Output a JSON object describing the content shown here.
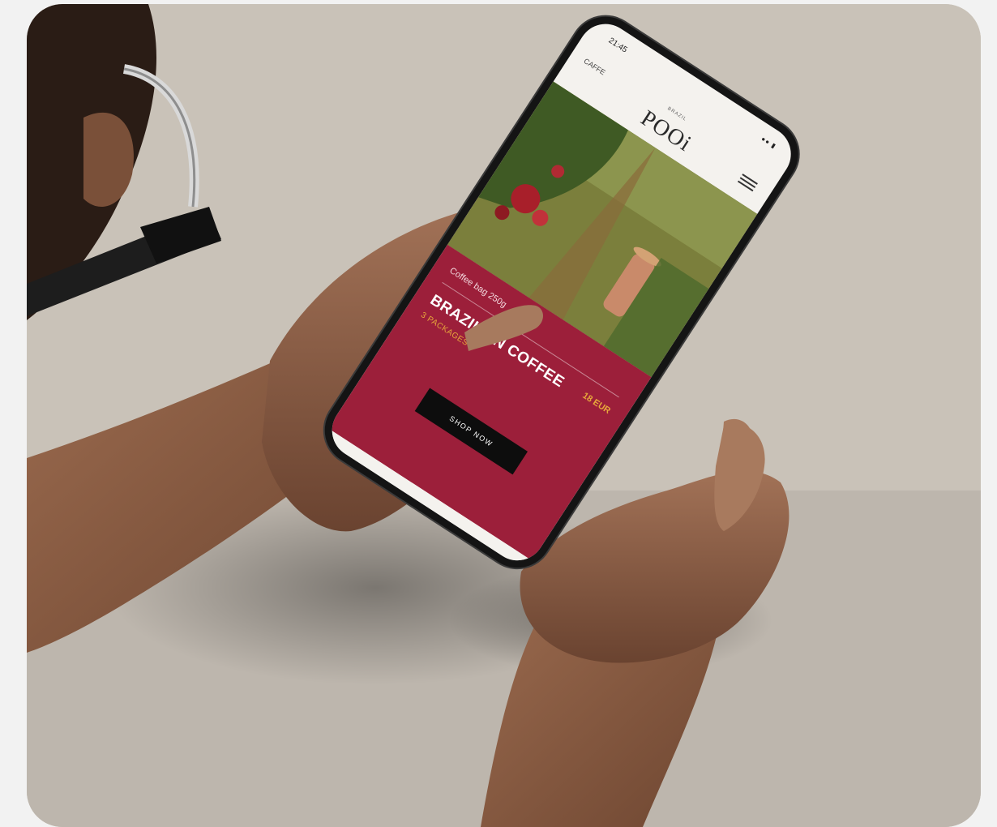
{
  "colors": {
    "page_background": "#f2f2f2",
    "tabletop": "#c8c1b7",
    "promo_panel": "#9c1f3a",
    "accent_gold": "#e7a73b",
    "button": "#0d0d0d",
    "phone_frame": "#141414"
  },
  "phone": {
    "status_time": "21:45",
    "status_icons": "●● ▮",
    "header_left": "CAFFE",
    "header_caption": "BRAZIL",
    "brand": "POOi",
    "icons": [
      "menu-icon"
    ],
    "promo": {
      "subtitle": "Coffee bag 250g",
      "title": "BRAZILIAN COFFEE",
      "price": "18 EUR",
      "detail": "3 PACKAGES",
      "button": "SHOP NOW"
    }
  }
}
